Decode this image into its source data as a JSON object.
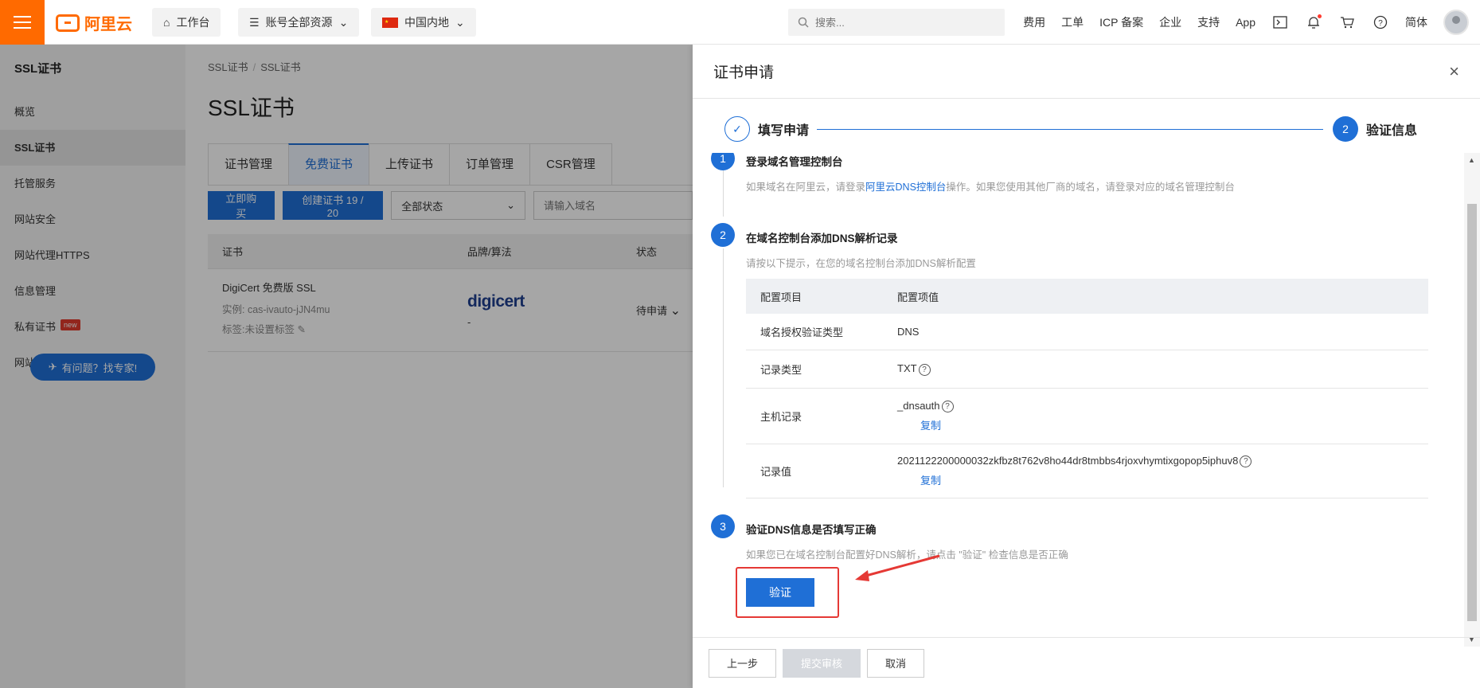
{
  "topbar": {
    "logo_text": "阿里云",
    "workbench": "工作台",
    "resources": "账号全部资源",
    "region": "中国内地",
    "search_placeholder": "搜索...",
    "links": [
      "费用",
      "工单",
      "ICP 备案",
      "企业",
      "支持",
      "App"
    ],
    "lang": "简体"
  },
  "sidebar": {
    "title": "SSL证书",
    "items": [
      {
        "label": "概览"
      },
      {
        "label": "SSL证书"
      },
      {
        "label": "托管服务"
      },
      {
        "label": "网站安全"
      },
      {
        "label": "网站代理HTTPS"
      },
      {
        "label": "信息管理"
      },
      {
        "label": "私有证书"
      },
      {
        "label": "网站防篡改"
      }
    ],
    "new_badge": "new",
    "help": "有问题？找专家!"
  },
  "main": {
    "breadcrumb": [
      "SSL证书",
      "SSL证书"
    ],
    "title": "SSL证书",
    "tabs": [
      "证书管理",
      "免费证书",
      "上传证书",
      "订单管理",
      "CSR管理"
    ],
    "buy_button": "立即购买",
    "create_button": "创建证书 19 / 20",
    "status_filter": "全部状态",
    "domain_placeholder": "请输入域名",
    "columns": [
      "证书",
      "品牌/算法",
      "状态"
    ],
    "row": {
      "name": "DigiCert 免费版 SSL",
      "instance": "实例: cas-ivauto-jJN4mu",
      "tag": "标签:未设置标签",
      "brand": "digicert",
      "algo": "-",
      "status": "待申请"
    }
  },
  "drawer": {
    "title": "证书申请",
    "steps": [
      "填写申请",
      "验证信息"
    ],
    "step2_num": "2",
    "sections": [
      {
        "num": "1",
        "title": "登录域名管理控制台",
        "desc_pre": "如果域名在阿里云，请登录",
        "desc_link": "阿里云DNS控制台",
        "desc_post": "操作。如果您使用其他厂商的域名，请登录对应的域名管理控制台"
      },
      {
        "num": "2",
        "title": "在域名控制台添加DNS解析记录",
        "desc": "请按以下提示，在您的域名控制台添加DNS解析配置"
      },
      {
        "num": "3",
        "title": "验证DNS信息是否填写正确",
        "desc": "如果您已在域名控制台配置好DNS解析，请点击 \"验证\" 检查信息是否正确"
      }
    ],
    "table_head": [
      "配置项目",
      "配置项值"
    ],
    "rows": [
      {
        "key": "域名授权验证类型",
        "value": "DNS"
      },
      {
        "key": "记录类型",
        "value": "TXT"
      },
      {
        "key": "主机记录",
        "value": "_dnsauth",
        "copy": "复制"
      },
      {
        "key": "记录值",
        "value": "2021122200000032zkfbz8t762v8ho44dr8tmbbs4rjoxvhymtixgopop5iphuv8",
        "copy": "复制"
      }
    ],
    "verify": "验证",
    "footer": {
      "prev": "上一步",
      "submit": "提交审核",
      "cancel": "取消"
    }
  }
}
